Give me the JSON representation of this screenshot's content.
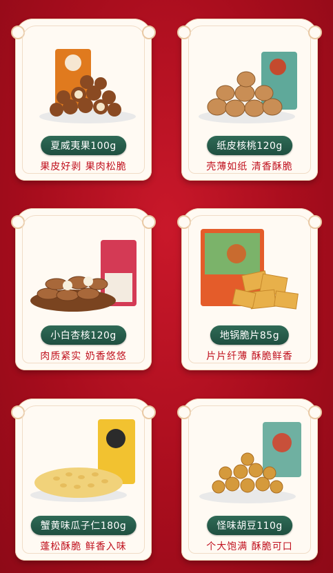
{
  "colors": {
    "background": "#b31022",
    "card": "#fffaf3",
    "pill": "#2f6a56",
    "tagline": "#c0121f"
  },
  "products": [
    {
      "name": "夏威夷果100g",
      "tagline": "果皮好剥 果肉松脆",
      "image": "macadamia-nuts"
    },
    {
      "name": "纸皮核桃120g",
      "tagline": "壳薄如纸 清香酥脆",
      "image": "walnuts"
    },
    {
      "name": "小白杏核120g",
      "tagline": "肉质紧实 奶香悠悠",
      "image": "apricot-kernels"
    },
    {
      "name": "地锅脆片85g",
      "tagline": "片片纤薄 酥脆鲜香",
      "image": "crispy-chips"
    },
    {
      "name": "蟹黄味瓜子仁180g",
      "tagline": "蓬松酥脆 鲜香入味",
      "image": "sunflower-seeds"
    },
    {
      "name": "怪味胡豆110g",
      "tagline": "个大饱满 酥脆可口",
      "image": "broad-beans"
    }
  ]
}
